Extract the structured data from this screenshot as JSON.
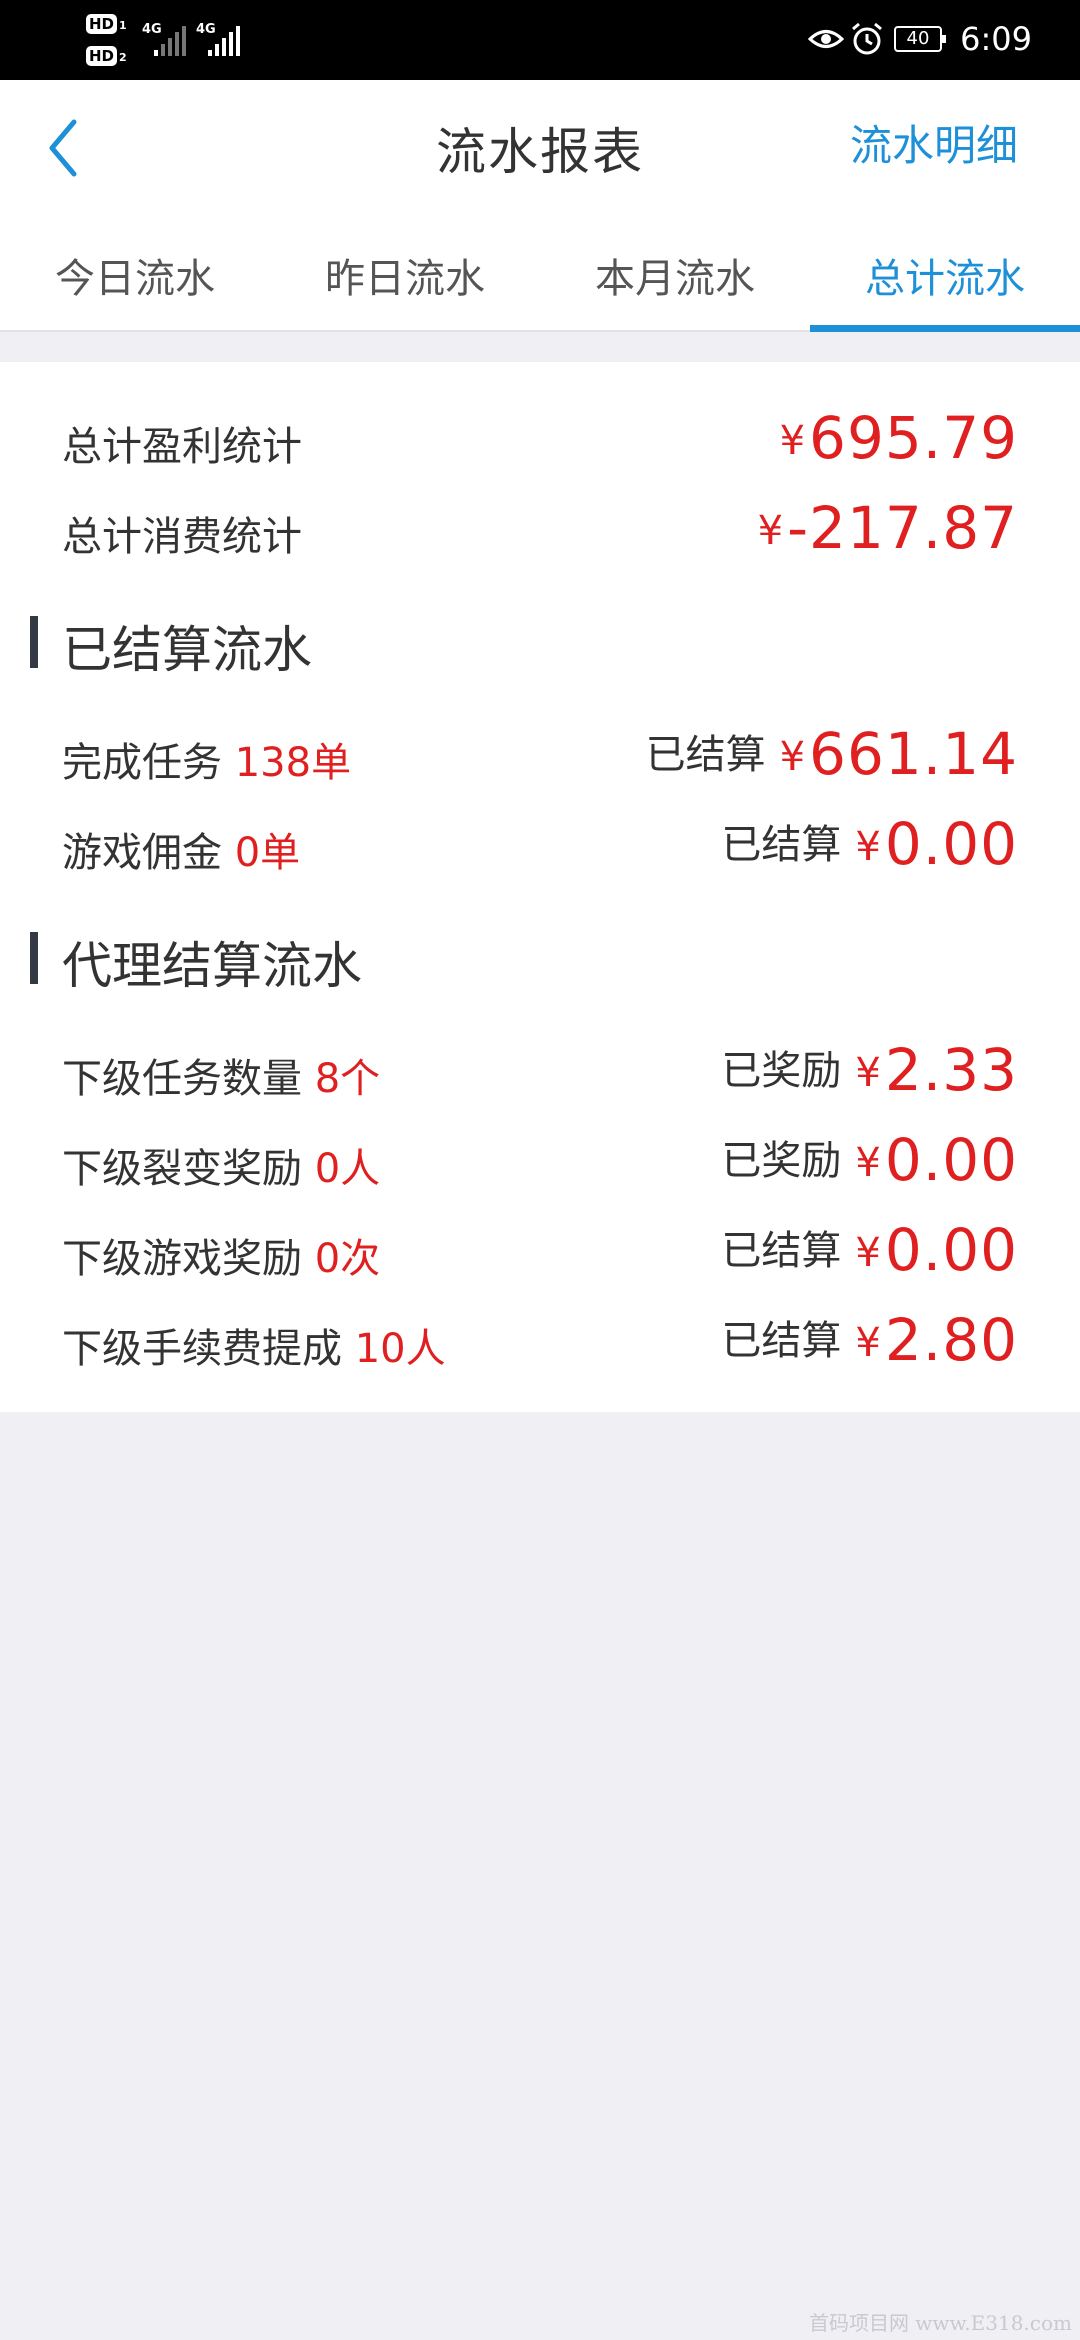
{
  "status_bar": {
    "hd1": "HD",
    "hd1_num": "1",
    "hd2": "HD",
    "hd2_num": "2",
    "net1": "4G",
    "net2": "4G",
    "battery": "40",
    "time": "6:09"
  },
  "header": {
    "title": "流水报表",
    "right_link": "流水明细"
  },
  "tabs": [
    {
      "label": "今日流水",
      "active": false
    },
    {
      "label": "昨日流水",
      "active": false
    },
    {
      "label": "本月流水",
      "active": false
    },
    {
      "label": "总计流水",
      "active": true
    }
  ],
  "summary": {
    "profit_label": "总计盈利统计",
    "profit_yen": "¥",
    "profit_value": "695.79",
    "consume_label": "总计消费统计",
    "consume_yen": "¥",
    "consume_value": "-217.87"
  },
  "settled": {
    "title": "已结算流水",
    "rows": [
      {
        "label": "完成任务",
        "count": "138单",
        "status": "已结算",
        "yen": "¥",
        "amount": "661.14"
      },
      {
        "label": "游戏佣金",
        "count": "0单",
        "status": "已结算",
        "yen": "¥",
        "amount": "0.00"
      }
    ]
  },
  "agent": {
    "title": "代理结算流水",
    "rows": [
      {
        "label": "下级任务数量",
        "count": "8个",
        "status": "已奖励",
        "yen": "¥",
        "amount": "2.33"
      },
      {
        "label": "下级裂变奖励",
        "count": "0人",
        "status": "已奖励",
        "yen": "¥",
        "amount": "0.00"
      },
      {
        "label": "下级游戏奖励",
        "count": "0次",
        "status": "已结算",
        "yen": "¥",
        "amount": "0.00"
      },
      {
        "label": "下级手续费提成",
        "count": "10人",
        "status": "已结算",
        "yen": "¥",
        "amount": "2.80"
      }
    ]
  },
  "watermark": "首码项目网 www.E318.com",
  "colors": {
    "accent": "#1e90d8",
    "money": "#e02020",
    "text": "#333333",
    "bg": "#efeff4"
  }
}
